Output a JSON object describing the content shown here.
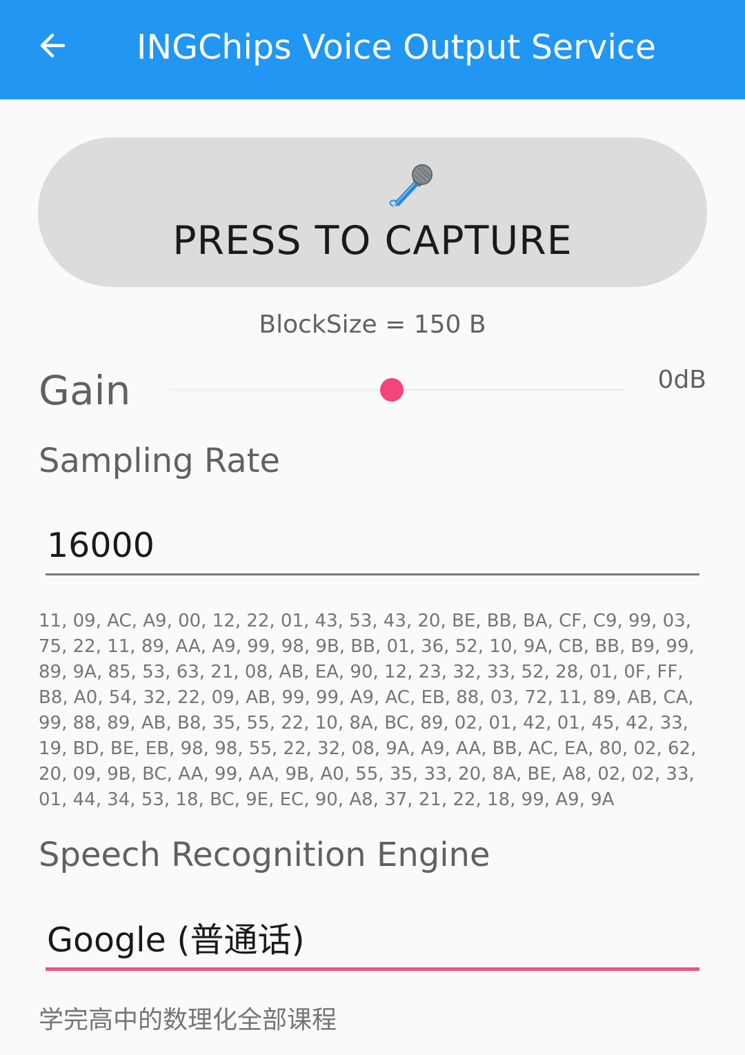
{
  "appbar": {
    "title": "INGChips Voice Output Service",
    "color": "#2196f3"
  },
  "capture": {
    "label": "PRESS TO CAPTURE",
    "icon": "microphone-icon"
  },
  "block_size": "BlockSize = 150 B",
  "gain": {
    "label": "Gain",
    "value_text": "0dB",
    "slider_fraction": 0.49,
    "thumb_color": "#f5437c"
  },
  "sampling_rate": {
    "label": "Sampling Rate",
    "value": "16000"
  },
  "hex_dump": "11, 09, AC, A9, 00, 12, 22, 01, 43, 53, 43, 20, BE, BB, BA, CF, C9, 99, 03, 75, 22, 11, 89, AA, A9, 99, 98, 9B, BB, 01, 36, 52, 10, 9A, CB, BB, B9, 99, 89, 9A, 85, 53, 63, 21, 08, AB, EA, 90, 12, 23, 32, 33, 52, 28, 01, 0F, FF, B8, A0, 54, 32, 22, 09, AB, 99, 99, A9, AC, EB, 88, 03, 72, 11, 89, AB, CA, 99, 88, 89, AB, B8, 35, 55, 22, 10, 8A, BC, 89, 02, 01, 42, 01, 45, 42, 33, 19, BD, BE, EB, 98, 98, 55, 22, 32, 08, 9A, A9, AA, BB, AC, EA, 80, 02, 62, 20, 09, 9B, BC, AA, 99, AA, 9B, A0, 55, 35, 33, 20, 8A, BE, A8, 02, 02, 33, 01, 44, 34, 53, 18, BC, 9E, EC, 90, A8, 37, 21, 22, 18, 99, A9, 9A",
  "engine": {
    "label": "Speech Recognition Engine",
    "value": "Google (普通话)",
    "accent": "#ef4f85"
  },
  "result_text": "学完高中的数理化全部课程"
}
